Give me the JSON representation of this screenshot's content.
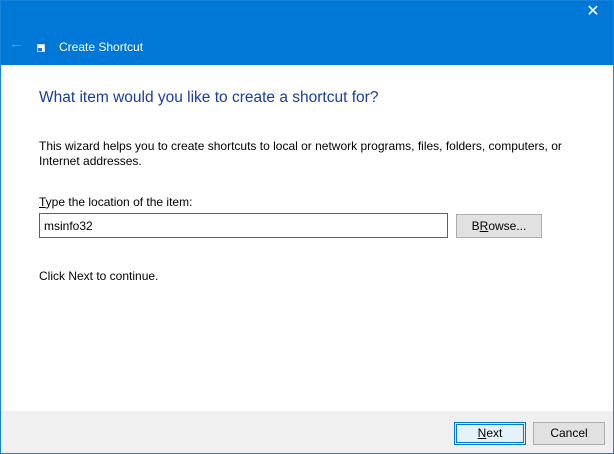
{
  "window": {
    "title": "Create Shortcut",
    "close_glyph": "✕",
    "back_glyph": "←"
  },
  "page": {
    "heading": "What item would you like to create a shortcut for?",
    "description": "This wizard helps you to create shortcuts to local or network programs, files, folders, computers, or Internet addresses.",
    "location_label_mnemonic": "T",
    "location_label_rest": "ype the location of the item:",
    "location_value": "msinfo32",
    "continue_text": "Click Next to continue."
  },
  "buttons": {
    "browse_mnemonic": "R",
    "browse_pre": "B",
    "browse_post": "owse...",
    "next_mnemonic": "N",
    "next_post": "ext",
    "cancel_label": "Cancel"
  },
  "colors": {
    "titlebar": "#0078d7",
    "heading": "#1a3d9e",
    "footer": "#f0f0f0"
  },
  "icons": {
    "back": "back-arrow-icon",
    "app": "shortcut-icon",
    "close": "close-icon"
  }
}
